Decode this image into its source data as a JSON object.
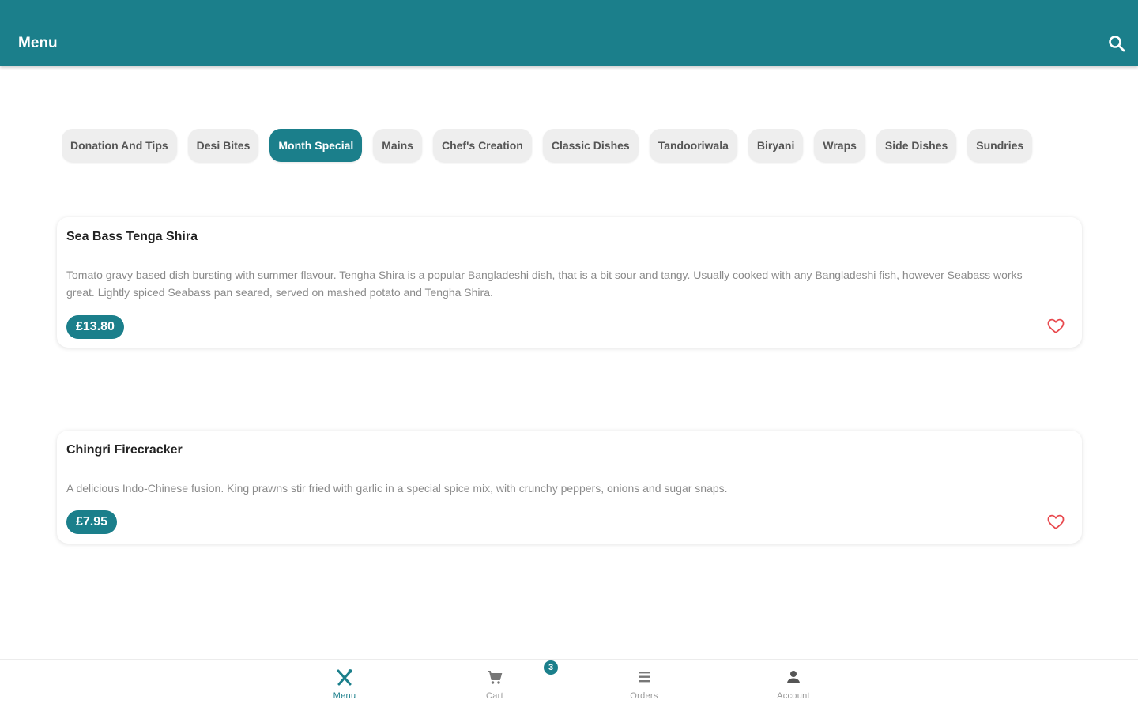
{
  "header": {
    "title": "Menu",
    "search_icon": "search-icon"
  },
  "categories": [
    {
      "label": "Donation And Tips",
      "active": false
    },
    {
      "label": "Desi Bites",
      "active": false
    },
    {
      "label": "Month Special",
      "active": true
    },
    {
      "label": "Mains",
      "active": false
    },
    {
      "label": "Chef's Creation",
      "active": false
    },
    {
      "label": "Classic Dishes",
      "active": false
    },
    {
      "label": "Tandooriwala",
      "active": false
    },
    {
      "label": "Biryani",
      "active": false
    },
    {
      "label": "Wraps",
      "active": false
    },
    {
      "label": "Side Dishes",
      "active": false
    },
    {
      "label": "Sundries",
      "active": false
    }
  ],
  "items": [
    {
      "name": "Sea Bass Tenga Shira",
      "description": "Tomato gravy based dish bursting with summer flavour. Tengha Shira is a popular Bangladeshi dish, that is a bit sour and tangy. Usually cooked with any Bangladeshi fish, however Seabass works great. Lightly spiced Seabass pan seared, served on mashed potato and Tengha Shira.",
      "price": "£13.80",
      "favorite_icon": "heart-outline-icon"
    },
    {
      "name": "Chingri Firecracker",
      "description": "A delicious Indo-Chinese fusion. King prawns stir fried with garlic in a special spice mix, with crunchy peppers, onions and sugar snaps.",
      "price": "£7.95",
      "favorite_icon": "heart-outline-icon"
    }
  ],
  "bottom_nav": [
    {
      "label": "Menu",
      "icon": "fork-knife-icon",
      "active": true
    },
    {
      "label": "Cart",
      "icon": "cart-icon",
      "active": false
    },
    {
      "label": "Orders",
      "icon": "list-icon",
      "active": false
    },
    {
      "label": "Account",
      "icon": "person-icon",
      "active": false
    }
  ],
  "cart_badge": "3",
  "colors": {
    "primary": "#1b7f8b",
    "favorite": "#e8474c",
    "chip_bg": "#eeeeee"
  }
}
